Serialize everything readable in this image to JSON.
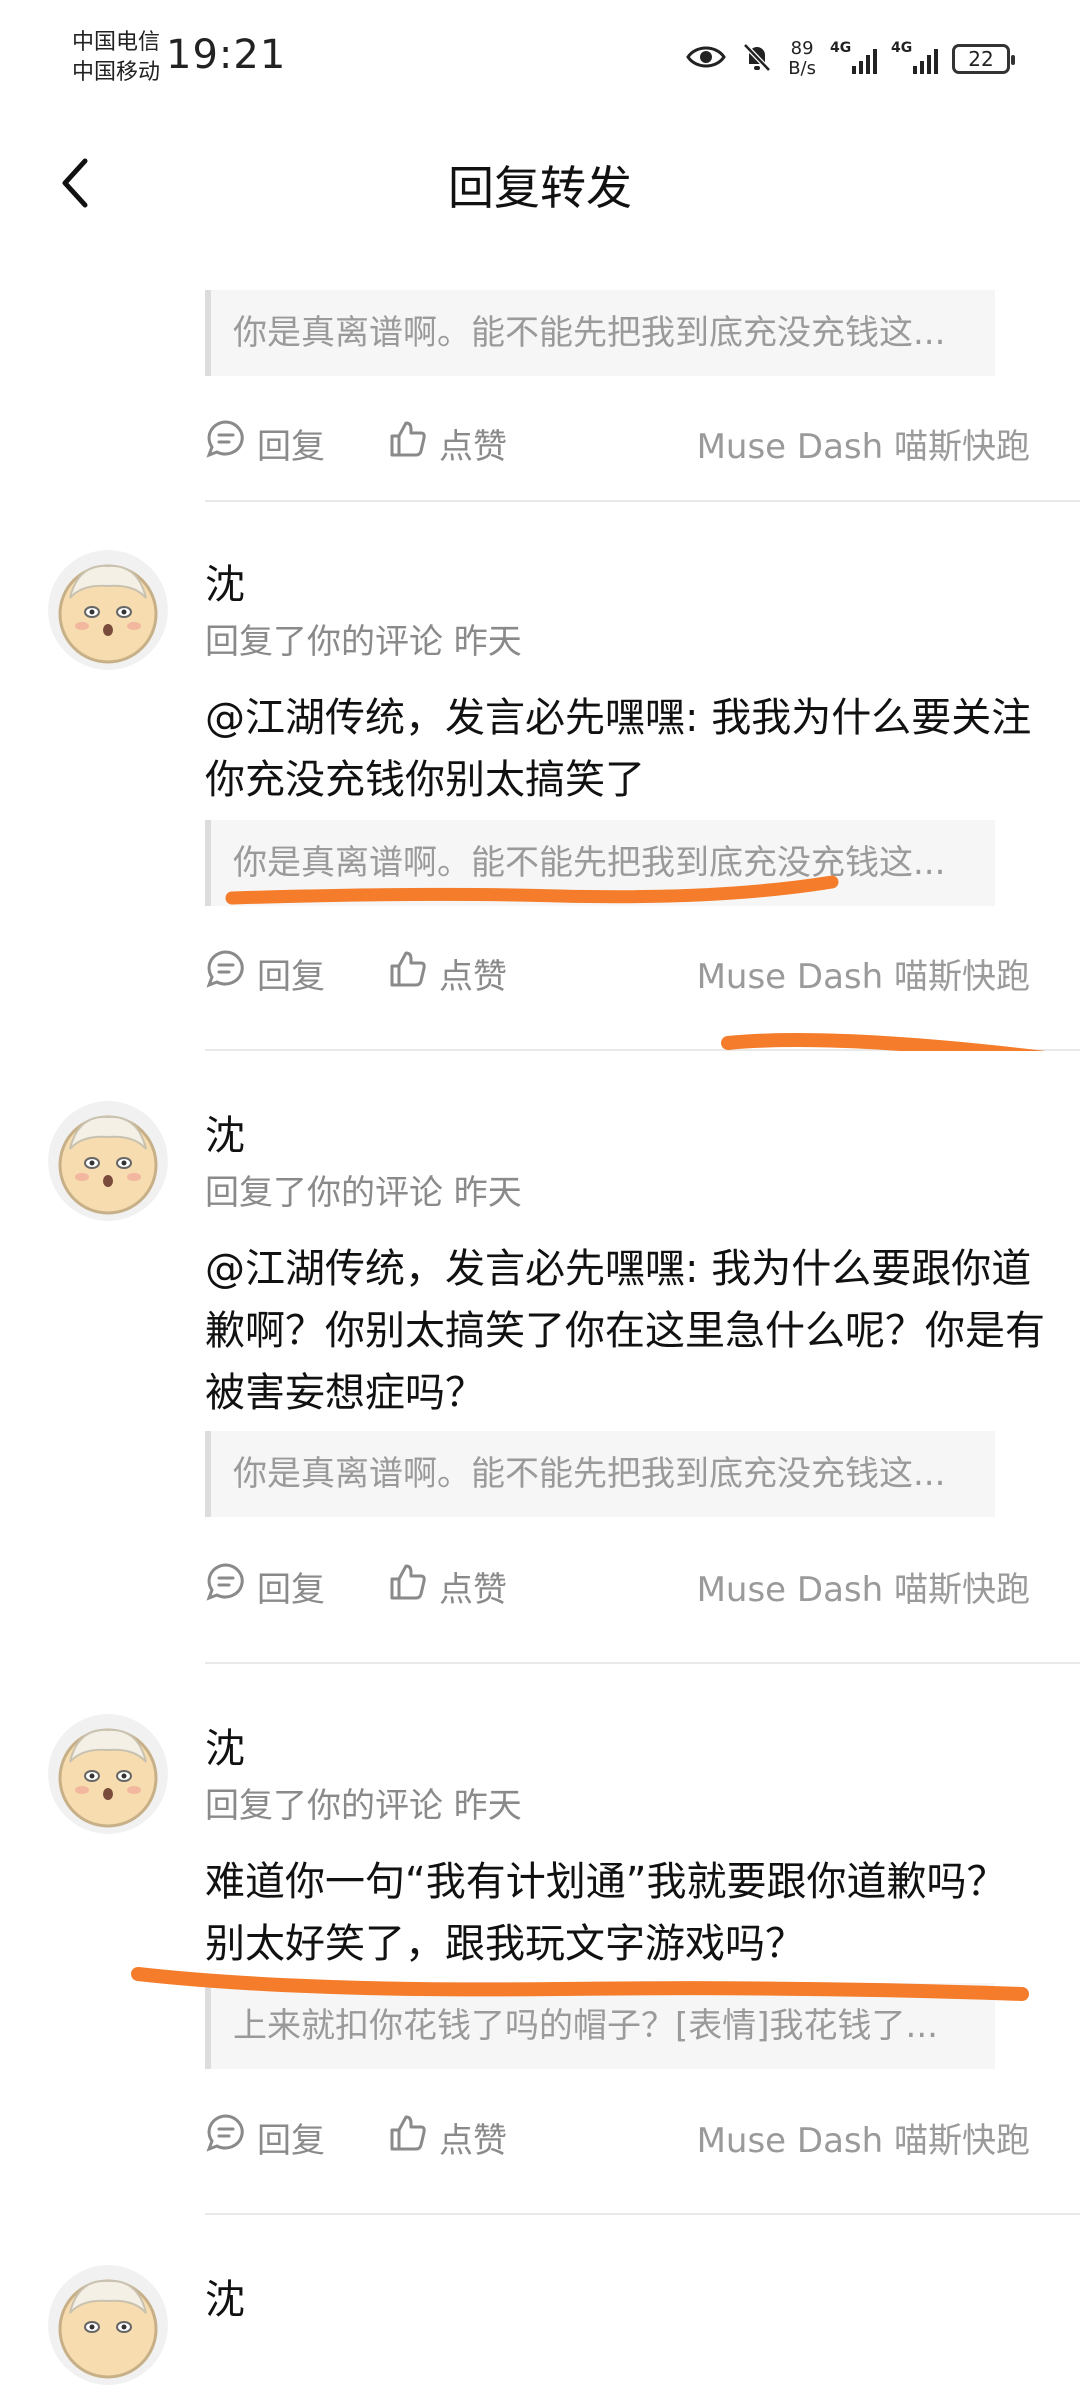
{
  "status_bar": {
    "carrier_1": "中国电信",
    "carrier_2": "中国移动",
    "time": "19:21",
    "net_speed_value": "89",
    "net_speed_unit": "B/s",
    "sig1_label": "4G",
    "sig2_label": "4G",
    "battery": "22"
  },
  "header": {
    "title": "回复转发"
  },
  "actions": {
    "reply": "回复",
    "like": "点赞"
  },
  "game_tag": "Muse Dash 喵斯快跑",
  "top_fragment": {
    "quote": "你是真离谱啊。能不能先把我到底充没充钱这..."
  },
  "comments": [
    {
      "name": "沈",
      "meta": "回复了你的评论 昨天",
      "content": "@江湖传统，发言必先嘿嘿: 我我为什么要关注你充没充钱你别太搞笑了",
      "quote": "你是真离谱啊。能不能先把我到底充没充钱这..."
    },
    {
      "name": "沈",
      "meta": "回复了你的评论 昨天",
      "content": "@江湖传统，发言必先嘿嘿: 我为什么要跟你道歉啊？你别太搞笑了你在这里急什么呢？你是有被害妄想症吗？",
      "quote": "你是真离谱啊。能不能先把我到底充没充钱这..."
    },
    {
      "name": "沈",
      "meta": "回复了你的评论 昨天",
      "content": "难道你一句“我有计划通”我就要跟你道歉吗？别太好笑了，跟我玩文字游戏吗？",
      "quote": "上来就扣你花钱了吗的帽子？[表情]我花钱了..."
    },
    {
      "name": "沈"
    }
  ],
  "colors": {
    "annotation": "#f47c2a",
    "muted": "#8a8a8a"
  }
}
